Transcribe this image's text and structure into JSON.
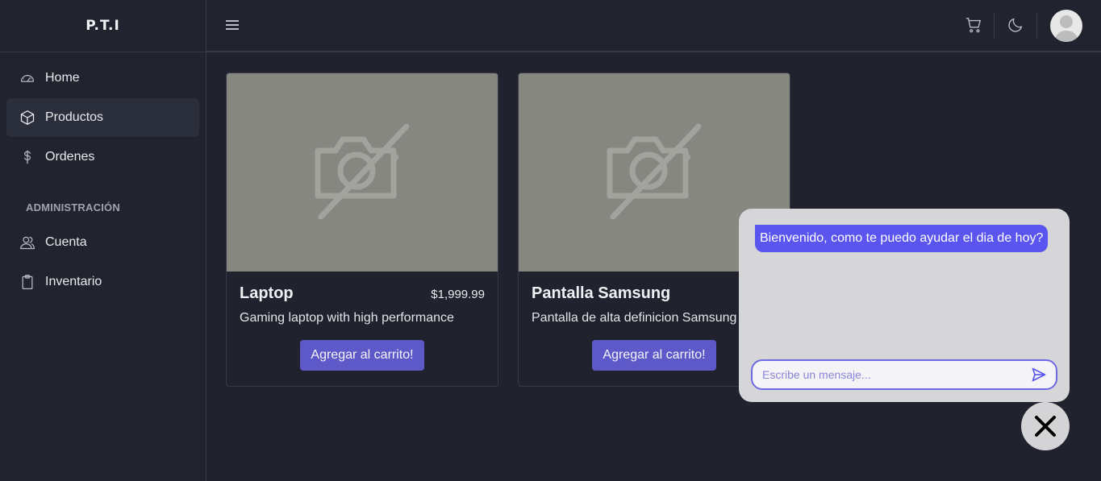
{
  "brand": "P.T.I",
  "nav": {
    "items": [
      {
        "label": "Home",
        "icon": "speedometer-icon"
      },
      {
        "label": "Productos",
        "icon": "cube-icon"
      },
      {
        "label": "Ordenes",
        "icon": "dollar-icon"
      }
    ],
    "section_title": "ADMINISTRACIÓN",
    "admin_items": [
      {
        "label": "Cuenta",
        "icon": "users-icon"
      },
      {
        "label": "Inventario",
        "icon": "clipboard-icon"
      }
    ]
  },
  "products": [
    {
      "title": "Laptop",
      "price": "$1,999.99",
      "description": "Gaming laptop with high performance",
      "button": "Agregar al carrito!"
    },
    {
      "title": "Pantalla Samsung",
      "price": "$",
      "description": "Pantalla de alta definicion Samsung",
      "button": "Agregar al carrito!"
    }
  ],
  "chat": {
    "welcome": "Bienvenido, como te puedo ayudar el dia de hoy?",
    "placeholder": "Escribe un mensaje..."
  },
  "colors": {
    "accent": "#5e59c9",
    "chat_bubble": "#5a55ee",
    "background": "#20232d",
    "image_placeholder": "#878782"
  }
}
